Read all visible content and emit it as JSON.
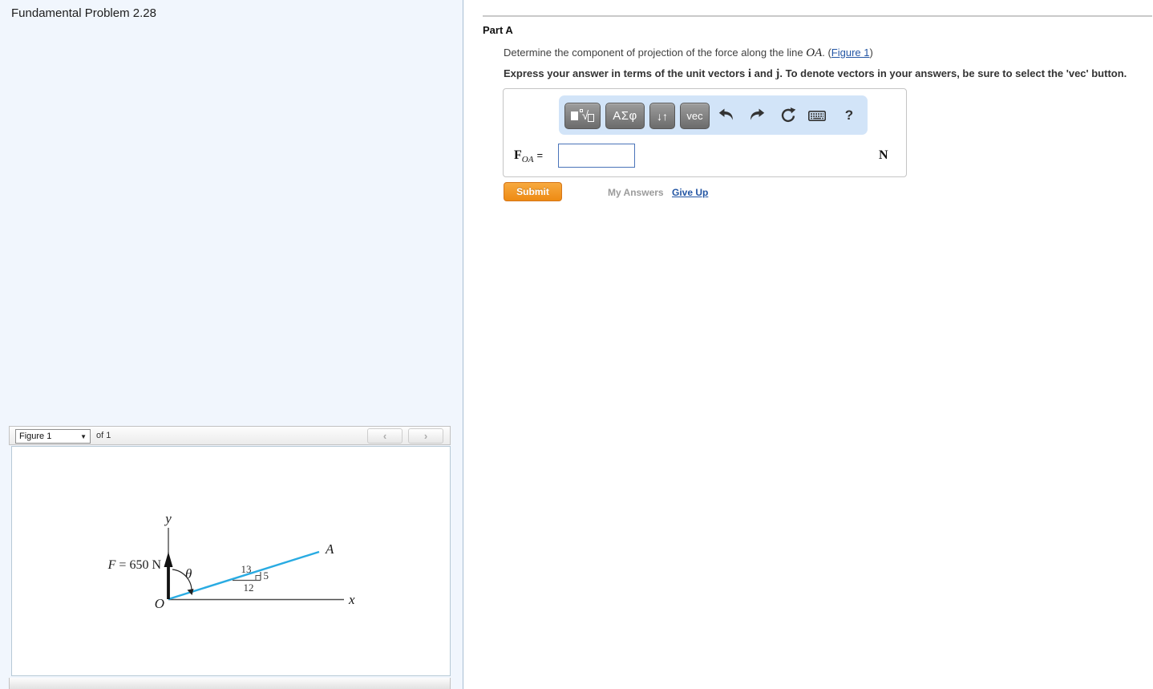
{
  "left_panel": {
    "title": "Fundamental Problem 2.28",
    "figure_bar": {
      "select_value": "Figure 1",
      "select_caret": "▼",
      "of_label": "of 1",
      "prev_icon": "‹",
      "next_icon": "›"
    },
    "figure": {
      "force_var": "F",
      "force_rest": " = 650 N",
      "angle": "θ",
      "axis_x": "x",
      "axis_y": "y",
      "origin": "O",
      "point_a": "A",
      "hyp": "13",
      "rise": "5",
      "run": "12",
      "line_color": "#29abe2"
    }
  },
  "part_a": {
    "heading": "Part A",
    "question": {
      "t1": "Determine the component of projection of the force along the line ",
      "oa": "OA",
      "t2": ". (",
      "link": "Figure 1",
      "t3": ")"
    },
    "instruction": {
      "t1": "Express your answer in terms of the unit vectors ",
      "i": "i",
      "t2": " and ",
      "j": "j",
      "t3": ". To denote vectors in your answers, be sure to select the 'vec' button."
    },
    "toolbar": {
      "templates_radical": "√",
      "greek": "ΑΣφ",
      "arrows": "↓↑",
      "vec": "vec",
      "help": "?",
      "icons": {
        "templates": "math-templates-icon",
        "undo": "undo-icon",
        "redo": "redo-icon",
        "reset": "reset-icon",
        "keyboard": "keyboard-icon",
        "help": "help-icon"
      }
    },
    "answer": {
      "f": "F",
      "sub": "OA",
      "equals": "=",
      "value": "",
      "unit": "N"
    },
    "actions": {
      "submit": "Submit",
      "my_answers": "My Answers",
      "give_up": "Give Up"
    }
  }
}
